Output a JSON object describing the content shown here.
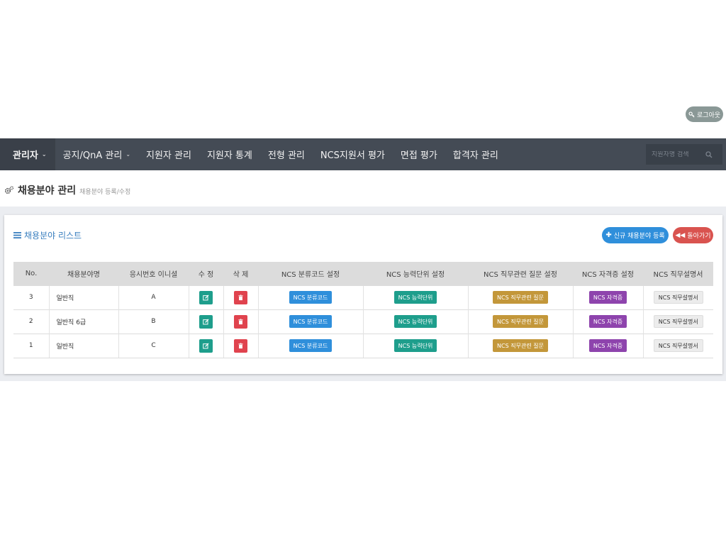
{
  "header": {
    "logout_label": "로그아웃"
  },
  "nav": {
    "items": [
      {
        "label": "관리자",
        "active": true,
        "caret": true
      },
      {
        "label": "공지/QnA 관리",
        "active": false,
        "caret": true
      },
      {
        "label": "지원자 관리",
        "active": false,
        "caret": false
      },
      {
        "label": "지원자 통계",
        "active": false,
        "caret": false
      },
      {
        "label": "전형 관리",
        "active": false,
        "caret": false
      },
      {
        "label": "NCS지원서 평가",
        "active": false,
        "caret": false
      },
      {
        "label": "면접 평가",
        "active": false,
        "caret": false
      },
      {
        "label": "합격자 관리",
        "active": false,
        "caret": false
      }
    ],
    "search_placeholder": "지원자명 검색"
  },
  "page": {
    "title": "채용분야 관리",
    "subtitle": "채용분야 등록/수정"
  },
  "panel": {
    "title": "채용분야 리스트",
    "new_button": "신규 채용분야 등록",
    "back_button": "돌아가기"
  },
  "table": {
    "headers": [
      "No.",
      "채용분야명",
      "응시번호 이니셜",
      "수 정",
      "삭 제",
      "NCS 분류코드 설정",
      "NCS 능력단위 설정",
      "NCS 직무관련 질문 설정",
      "NCS 자격증 설정",
      "NCS 직무설명서"
    ],
    "rows": [
      {
        "no": "3",
        "name": "일반직",
        "initial": "A"
      },
      {
        "no": "2",
        "name": "일반직 6급",
        "initial": "B"
      },
      {
        "no": "1",
        "name": "일반직",
        "initial": "C"
      }
    ],
    "buttons": {
      "classification": "NCS 분류코드",
      "ability": "NCS 능력단위",
      "question": "NCS 직무관련 질문",
      "certificate": "NCS 자격증",
      "description": "NCS 직무설명서"
    }
  },
  "colors": {
    "navbar": "#444b55",
    "primary": "#2f8fdb",
    "teal": "#1e9e8c",
    "danger": "#e0434e",
    "gold": "#c3973a",
    "purple": "#8e44ad"
  }
}
